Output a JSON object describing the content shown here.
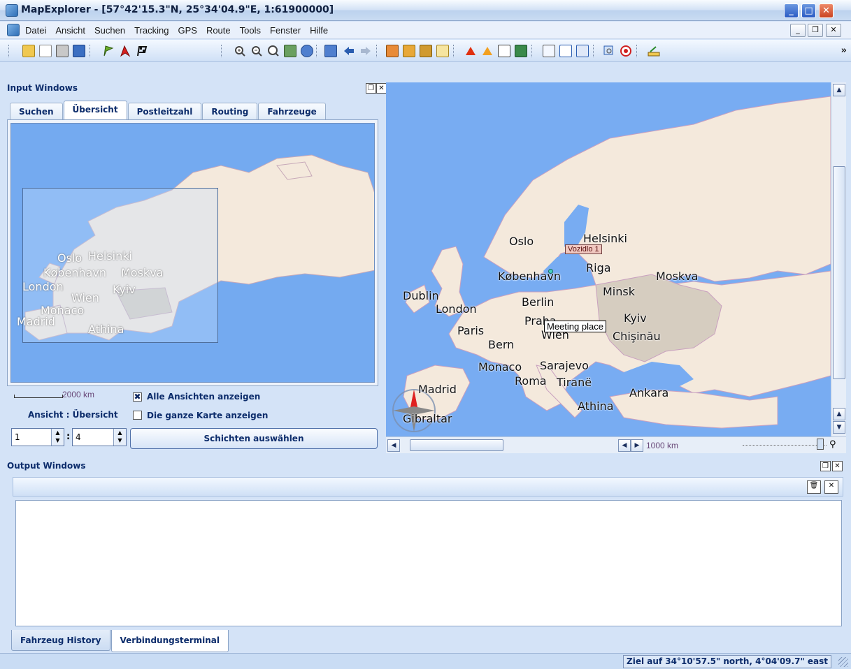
{
  "window": {
    "title": "MapExplorer - [57°42'15.3\"N, 25°34'04.9\"E, 1:61900000]"
  },
  "menu": {
    "items": [
      "Datei",
      "Ansicht",
      "Suchen",
      "Tracking",
      "GPS",
      "Route",
      "Tools",
      "Fenster",
      "Hilfe"
    ]
  },
  "toolbar": {
    "icons": [
      "open-folder-icon",
      "copy-icon",
      "print-icon",
      "save-icon",
      "green-flag-icon",
      "red-flag-icon",
      "checkered-flag-icon",
      "zoom-in-icon",
      "zoom-out-icon",
      "zoom-100-icon",
      "map-icon",
      "globe-icon",
      "back-icon",
      "forward-icon",
      "pin-add-icon",
      "pin-remove-icon",
      "layers-icon",
      "export-icon",
      "red-triangle-icon",
      "warning-triangle-icon",
      "target-icon",
      "book-icon",
      "fullscreen-icon",
      "split-view-icon",
      "window-icon",
      "search-map-icon",
      "record-icon",
      "ruler-icon"
    ]
  },
  "input_windows": {
    "title": "Input Windows",
    "tabs": [
      "Suchen",
      "Übersicht",
      "Postleitzahl",
      "Routing",
      "Fahrzeuge"
    ],
    "active_tab": "Übersicht",
    "overview_cities": [
      {
        "name": "Oslo"
      },
      {
        "name": "Helsinki"
      },
      {
        "name": "København"
      },
      {
        "name": "Moskva"
      },
      {
        "name": "London"
      },
      {
        "name": "Kyiv"
      },
      {
        "name": "Wien"
      },
      {
        "name": "Monaco"
      },
      {
        "name": "Madrid"
      },
      {
        "name": "Athina"
      }
    ],
    "scale_label": "2000 km",
    "checkbox_all_views": {
      "label": "Alle Ansichten anzeigen",
      "checked": true
    },
    "view_label": "Ansicht : Übersicht",
    "checkbox_whole_map": {
      "label": "Die ganze Karte anzeigen",
      "checked": false
    },
    "layer_from": "1",
    "layer_to": "4",
    "layer_button": "Schichten auswählen"
  },
  "main_map": {
    "cities": [
      "Oslo",
      "Helsinki",
      "Riga",
      "København",
      "Moskva",
      "Dublin",
      "Minsk",
      "London",
      "Berlin",
      "Kyiv",
      "Praha",
      "Paris",
      "Wien",
      "Chişinău",
      "Bern",
      "Monaco",
      "Sarajevo",
      "Roma",
      "Tiranë",
      "Madrid",
      "Ankara",
      "Athina",
      "Gibraltar"
    ],
    "vehicle_tag": "Vozidlo 1",
    "meeting_tag": "Meeting place",
    "scale_label": "1000 km"
  },
  "output_windows": {
    "title": "Output Windows",
    "tabs": [
      "Fahrzeug History",
      "Verbindungsterminal"
    ],
    "active_tab": "Verbindungsterminal"
  },
  "status": {
    "text": "Ziel auf 34°10'57.5\" north, 4°04'09.7\" east"
  },
  "colors": {
    "sea": "#78acf2",
    "land": "#f4e9dc",
    "highlight_land": "#d6cdc0",
    "title_text": "#0c2c6b"
  }
}
